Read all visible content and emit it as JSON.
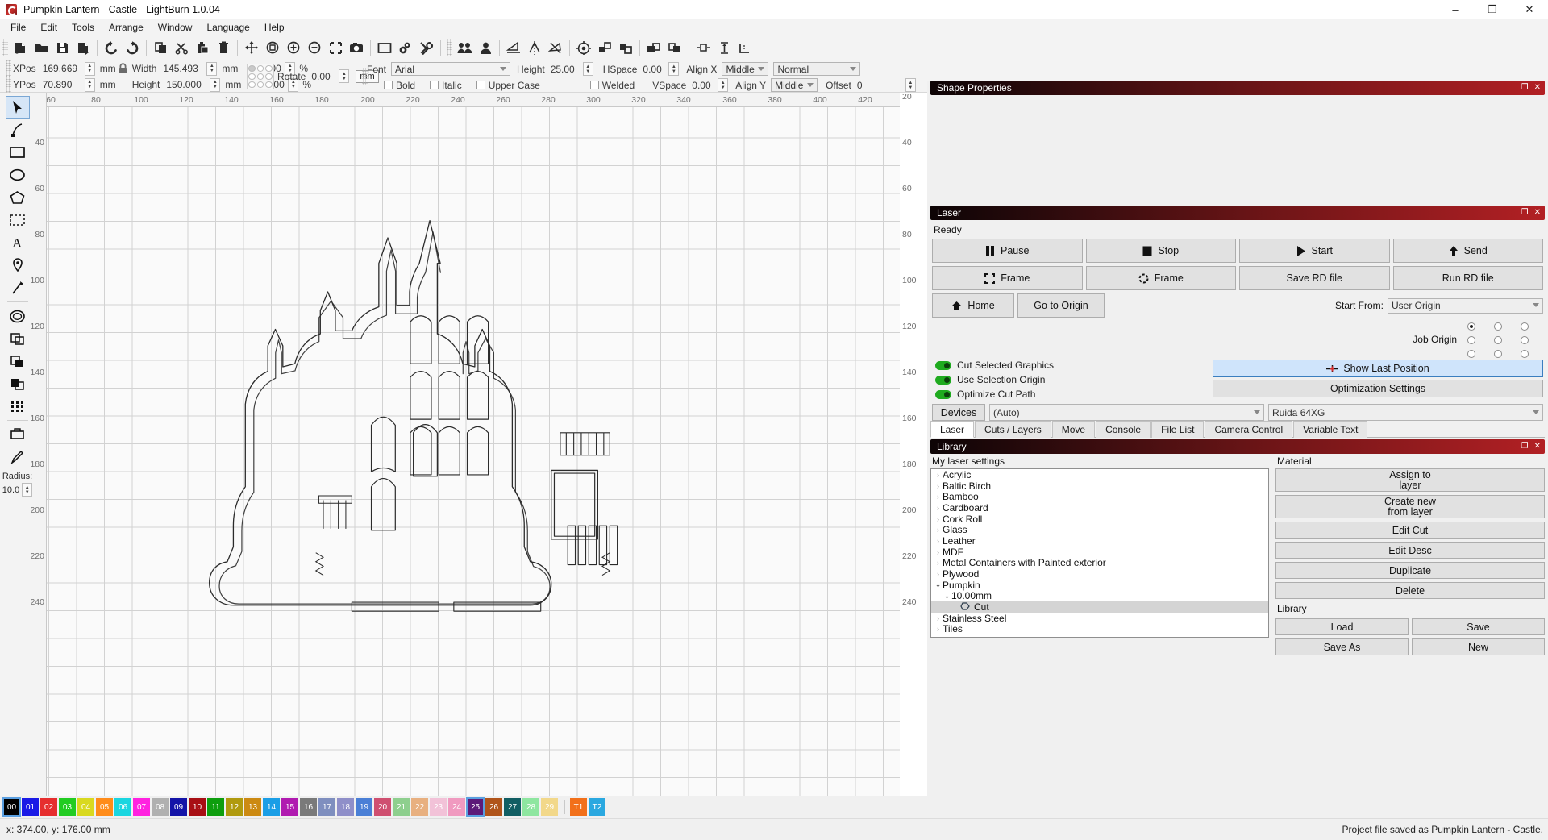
{
  "window": {
    "title": "Pumpkin Lantern - Castle - LightBurn 1.0.04",
    "minimize": "–",
    "maximize": "❐",
    "close": "✕"
  },
  "menu": {
    "items": [
      "File",
      "Edit",
      "Tools",
      "Arrange",
      "Window",
      "Language",
      "Help"
    ]
  },
  "toolbar": {
    "icons": [
      "new-file-icon",
      "open-file-icon",
      "save-file-icon",
      "export-file-icon",
      "undo-icon",
      "redo-icon",
      "copy-icon",
      "cut-icon",
      "paste-icon",
      "delete-icon",
      "move-icon",
      "zoom-fit-icon",
      "zoom-in-icon",
      "zoom-out-icon",
      "zoom-selection-icon",
      "camera-capture-icon",
      "frame-preview-icon",
      "settings-gear-icon",
      "machine-settings-icon",
      "group-icon",
      "ungroup-icon",
      "mirror-horizontal-icon",
      "mirror-vertical-icon",
      "rotate-icon",
      "align-center-icon",
      "weld-icon",
      "boolean-union-icon",
      "boolean-subtract-icon",
      "boolean-intersect-icon",
      "distribute-h-icon",
      "distribute-v-icon",
      "measure-icon"
    ]
  },
  "properties": {
    "xpos_label": "XPos",
    "xpos_value": "169.669",
    "ypos_label": "YPos",
    "ypos_value": "70.890",
    "width_label": "Width",
    "width_value": "145.493",
    "height_label": "Height",
    "height_value": "150.000",
    "width_pct": "100.000",
    "height_pct": "100.000",
    "unit": "mm",
    "pct": "%",
    "rotate_label": "Rotate",
    "rotate_value": "0.00",
    "rotate_unit": "mm",
    "lock_icon": "lock-icon",
    "font_label": "Font",
    "font_value": "Arial",
    "text_height_label": "Height",
    "text_height_value": "25.00",
    "hspace_label": "HSpace",
    "hspace_value": "0.00",
    "vspace_label": "VSpace",
    "vspace_value": "0.00",
    "align_x_label": "Align X",
    "align_x_value": "Middle",
    "align_y_label": "Align Y",
    "align_y_value": "Middle",
    "normal_value": "Normal",
    "offset_label": "Offset",
    "offset_value": "0",
    "bold_label": "Bold",
    "italic_label": "Italic",
    "upper_case_label": "Upper Case",
    "welded_label": "Welded"
  },
  "left_tools": {
    "items": [
      {
        "name": "select-tool",
        "selected": true
      },
      {
        "name": "edit-nodes-tool",
        "selected": false
      },
      {
        "name": "rectangle-tool",
        "selected": false
      },
      {
        "name": "ellipse-tool",
        "selected": false
      },
      {
        "name": "polygon-tool",
        "selected": false
      },
      {
        "name": "linear-array-tool",
        "selected": false
      },
      {
        "name": "text-tool",
        "selected": false
      },
      {
        "name": "position-marker-tool",
        "selected": false
      },
      {
        "name": "draw-line-tool",
        "selected": false
      },
      {
        "name": "offset-shapes-tool",
        "selected": false
      },
      {
        "name": "boolean-union-tool",
        "selected": false
      },
      {
        "name": "boolean-subtract-tool",
        "selected": false
      },
      {
        "name": "boolean-intersect-tool",
        "selected": false
      },
      {
        "name": "grid-array-tool",
        "selected": false
      },
      {
        "name": "print-cut-tool",
        "selected": false
      },
      {
        "name": "pen-tool",
        "selected": false
      }
    ],
    "radius_label": "Radius:",
    "radius_value": "10.0"
  },
  "canvas": {
    "ruler_top_ticks": [
      "60",
      "80",
      "100",
      "120",
      "140",
      "160",
      "180",
      "200",
      "220",
      "240",
      "260",
      "280",
      "300",
      "320",
      "340",
      "360",
      "380",
      "400",
      "420"
    ],
    "ruler_left_ticks": [
      "40",
      "60",
      "80",
      "100",
      "120",
      "140",
      "160",
      "180",
      "200",
      "220",
      "240"
    ],
    "ruler_right_ticks": [
      "20",
      "40",
      "60",
      "80",
      "100",
      "120",
      "140",
      "160",
      "180",
      "200",
      "220",
      "240"
    ]
  },
  "shape_properties": {
    "title": "Shape Properties",
    "float_icon": "float-panel-icon",
    "close_icon": "close-panel-icon"
  },
  "laser": {
    "title": "Laser",
    "status": "Ready",
    "buttons": {
      "pause": "Pause",
      "stop": "Stop",
      "start": "Start",
      "send": "Send",
      "frame_square": "Frame",
      "frame_round": "Frame",
      "save_rd": "Save RD file",
      "run_rd": "Run RD file",
      "home": "Home",
      "go_to_origin": "Go to Origin",
      "show_last_position": "Show Last Position",
      "optimization_settings": "Optimization Settings",
      "devices": "Devices"
    },
    "start_from_label": "Start From:",
    "start_from_value": "User Origin",
    "job_origin_label": "Job Origin",
    "toggles": [
      {
        "label": "Cut Selected Graphics",
        "on": true
      },
      {
        "label": "Use Selection Origin",
        "on": true
      },
      {
        "label": "Optimize Cut Path",
        "on": true
      }
    ],
    "device_auto": "(Auto)",
    "device_model": "Ruida 64XG"
  },
  "tabs": {
    "items": [
      "Laser",
      "Cuts / Layers",
      "Move",
      "Console",
      "File List",
      "Camera Control",
      "Variable Text"
    ],
    "active": "Laser"
  },
  "library": {
    "title": "Library",
    "settings_label": "My laser settings",
    "material_label": "Material",
    "library_group_label": "Library",
    "tree": [
      {
        "label": "Acrylic",
        "depth": 0,
        "expanded": false,
        "has_children": true,
        "selected": false
      },
      {
        "label": "Baltic Birch",
        "depth": 0,
        "expanded": false,
        "has_children": true,
        "selected": false
      },
      {
        "label": "Bamboo",
        "depth": 0,
        "expanded": false,
        "has_children": true,
        "selected": false
      },
      {
        "label": "Cardboard",
        "depth": 0,
        "expanded": false,
        "has_children": true,
        "selected": false
      },
      {
        "label": "Cork Roll",
        "depth": 0,
        "expanded": false,
        "has_children": true,
        "selected": false
      },
      {
        "label": "Glass",
        "depth": 0,
        "expanded": false,
        "has_children": true,
        "selected": false
      },
      {
        "label": "Leather",
        "depth": 0,
        "expanded": false,
        "has_children": true,
        "selected": false
      },
      {
        "label": "MDF",
        "depth": 0,
        "expanded": false,
        "has_children": true,
        "selected": false
      },
      {
        "label": "Metal Containers with Painted exterior",
        "depth": 0,
        "expanded": false,
        "has_children": true,
        "selected": false
      },
      {
        "label": "Plywood",
        "depth": 0,
        "expanded": false,
        "has_children": true,
        "selected": false
      },
      {
        "label": "Pumpkin",
        "depth": 0,
        "expanded": true,
        "has_children": true,
        "selected": false
      },
      {
        "label": "10.00mm",
        "depth": 1,
        "expanded": true,
        "has_children": true,
        "selected": false
      },
      {
        "label": "Cut",
        "depth": 2,
        "expanded": false,
        "has_children": false,
        "selected": true
      },
      {
        "label": "Stainless Steel",
        "depth": 0,
        "expanded": false,
        "has_children": true,
        "selected": false
      },
      {
        "label": "Tiles",
        "depth": 0,
        "expanded": false,
        "has_children": true,
        "selected": false
      }
    ],
    "material_buttons": [
      "Assign to\nlayer",
      "Create new\nfrom layer",
      "Edit Cut",
      "Edit Desc",
      "Duplicate",
      "Delete"
    ],
    "assign_to_layer_l1": "Assign to",
    "assign_to_layer_l2": "layer",
    "create_new_l1": "Create new",
    "create_new_l2": "from layer",
    "edit_cut": "Edit Cut",
    "edit_desc": "Edit Desc",
    "duplicate": "Duplicate",
    "delete": "Delete",
    "load": "Load",
    "save": "Save",
    "save_as": "Save As",
    "new": "New"
  },
  "palette": {
    "swatches": [
      {
        "label": "00",
        "color": "#000000",
        "selected": true
      },
      {
        "label": "01",
        "color": "#1a1ae6"
      },
      {
        "label": "02",
        "color": "#e62e2e"
      },
      {
        "label": "03",
        "color": "#22cc22"
      },
      {
        "label": "04",
        "color": "#d9d91f"
      },
      {
        "label": "05",
        "color": "#ff8c1a"
      },
      {
        "label": "06",
        "color": "#19d6e0"
      },
      {
        "label": "07",
        "color": "#ff22e0"
      },
      {
        "label": "08",
        "color": "#b0b0b0"
      },
      {
        "label": "09",
        "color": "#1414a8"
      },
      {
        "label": "10",
        "color": "#a80f14"
      },
      {
        "label": "11",
        "color": "#0e9e0e"
      },
      {
        "label": "12",
        "color": "#b09a0e"
      },
      {
        "label": "13",
        "color": "#cc8a12"
      },
      {
        "label": "14",
        "color": "#1a9ee6"
      },
      {
        "label": "15",
        "color": "#b01ab0"
      },
      {
        "label": "16",
        "color": "#7a7a7a"
      },
      {
        "label": "17",
        "color": "#7f8fbf"
      },
      {
        "label": "18",
        "color": "#8f8fc9"
      },
      {
        "label": "19",
        "color": "#4a7fd6"
      },
      {
        "label": "20",
        "color": "#cf4f70"
      },
      {
        "label": "21",
        "color": "#8ecf8e"
      },
      {
        "label": "22",
        "color": "#e8b080"
      },
      {
        "label": "23",
        "color": "#f2c2d8"
      },
      {
        "label": "24",
        "color": "#f09ac0"
      },
      {
        "label": "25",
        "color": "#5c1a78",
        "selected": true
      },
      {
        "label": "26",
        "color": "#b0541a"
      },
      {
        "label": "27",
        "color": "#115e63"
      },
      {
        "label": "28",
        "color": "#8ee6a0"
      },
      {
        "label": "29",
        "color": "#f2d88a"
      },
      {
        "label": "T1",
        "color": "#f2701a"
      },
      {
        "label": "T2",
        "color": "#2aa8e0"
      }
    ]
  },
  "status": {
    "coords": "x: 374.00, y: 176.00 mm",
    "message": "Project file saved as Pumpkin Lantern - Castle."
  }
}
